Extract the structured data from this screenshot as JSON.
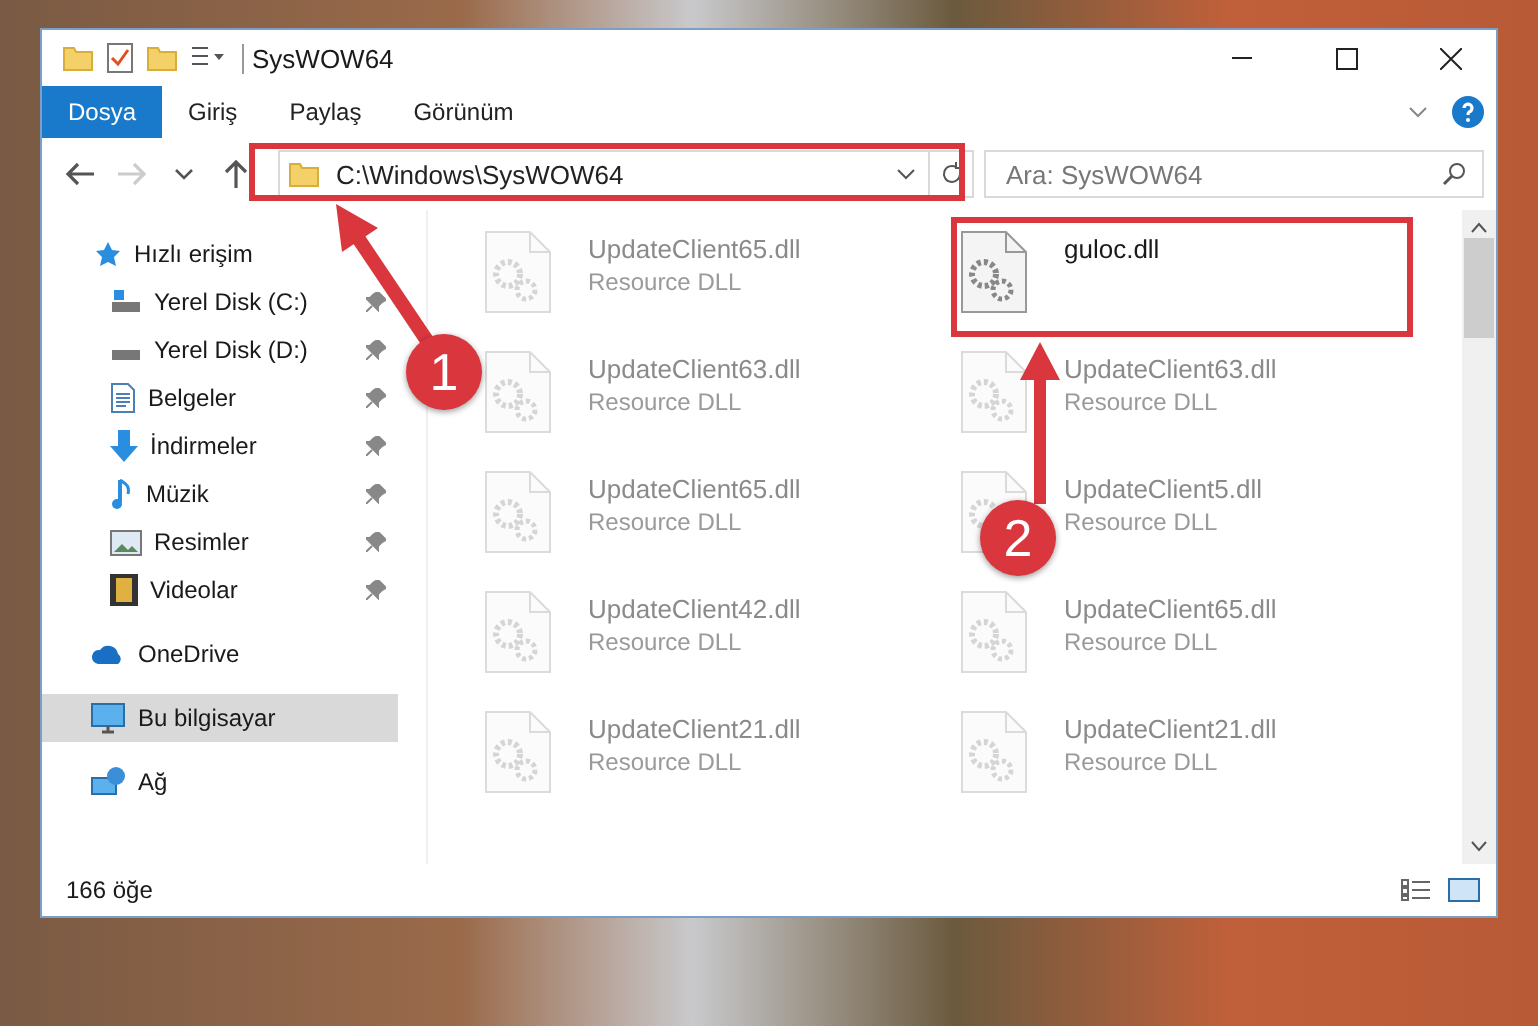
{
  "window": {
    "title": "SysWOW64"
  },
  "ribbon_tabs": [
    {
      "label": "Dosya",
      "selected": true
    },
    {
      "label": "Giriş",
      "selected": false
    },
    {
      "label": "Paylaş",
      "selected": false
    },
    {
      "label": "Görünüm",
      "selected": false
    }
  ],
  "nav_buttons": [
    {
      "kind": "back",
      "disabled": false
    },
    {
      "kind": "forward",
      "disabled": true
    },
    {
      "kind": "recent",
      "disabled": false
    },
    {
      "kind": "up",
      "disabled": false
    }
  ],
  "address": {
    "value": "C:\\Windows\\SysWOW64"
  },
  "search": {
    "placeholder": "Ara: SysWOW64"
  },
  "sidebar": {
    "items": [
      {
        "label": "Hızlı erişim",
        "kind": "quick",
        "selected": false,
        "children": [
          {
            "label": "Yerel Disk (C:)",
            "kind": "drive-c",
            "pinned": true,
            "selected": false
          },
          {
            "label": "Yerel Disk (D:)",
            "kind": "drive",
            "pinned": true,
            "selected": false
          },
          {
            "label": "Belgeler",
            "kind": "documents",
            "pinned": true,
            "selected": false
          },
          {
            "label": "İndirmeler",
            "kind": "downloads",
            "pinned": true,
            "selected": false
          },
          {
            "label": "Müzik",
            "kind": "music",
            "pinned": true,
            "selected": false
          },
          {
            "label": "Resimler",
            "kind": "pictures",
            "pinned": true,
            "selected": false
          },
          {
            "label": "Videolar",
            "kind": "videos",
            "pinned": true,
            "selected": false
          }
        ]
      },
      {
        "label": "OneDrive",
        "kind": "cloud",
        "selected": false
      },
      {
        "label": "Bu bilgisayar",
        "kind": "computer",
        "selected": true
      },
      {
        "label": "Ağ",
        "kind": "network",
        "selected": false
      }
    ]
  },
  "files": [
    {
      "name": "UpdateClient65.dll",
      "type": "Resource DLL",
      "dimmed": true
    },
    {
      "name": "guloc.dll",
      "dimmed": false
    },
    {
      "name": "UpdateClient63.dll",
      "type": "Resource DLL",
      "dimmed": true
    },
    {
      "name": "UpdateClient63.dll",
      "type": "Resource DLL",
      "dimmed": true
    },
    {
      "name": "UpdateClient65.dll",
      "type": "Resource DLL",
      "dimmed": true
    },
    {
      "name": "UpdateClient5.dll",
      "type": "Resource DLL",
      "dimmed": true
    },
    {
      "name": "UpdateClient42.dll",
      "type": "Resource DLL",
      "dimmed": true
    },
    {
      "name": "UpdateClient65.dll",
      "type": "Resource DLL",
      "dimmed": true
    },
    {
      "name": "UpdateClient21.dll",
      "type": "Resource DLL",
      "dimmed": true
    },
    {
      "name": "UpdateClient21.dll",
      "type": "Resource DLL",
      "dimmed": true
    }
  ],
  "status_bar": {
    "count": "166 öğe"
  },
  "annotations": [
    {
      "number": "1"
    },
    {
      "number": "2"
    }
  ]
}
